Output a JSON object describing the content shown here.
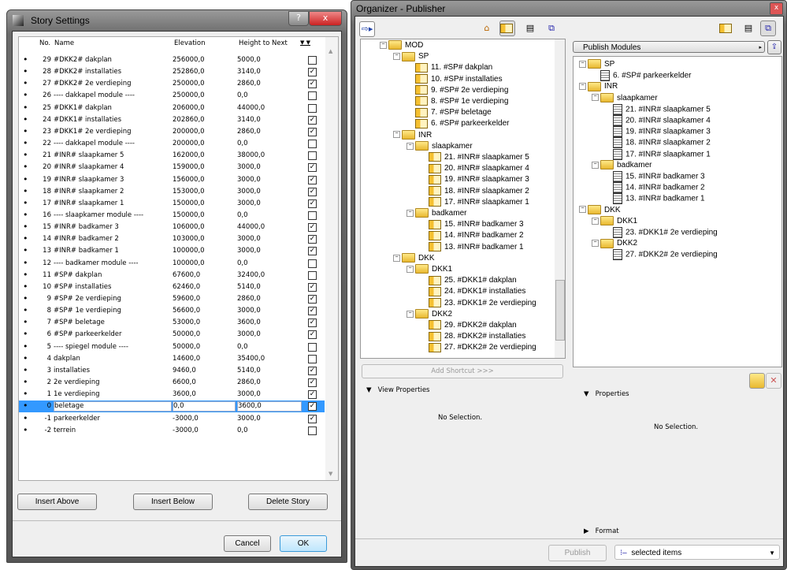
{
  "story_settings": {
    "title": "Story Settings",
    "help": "?",
    "close": "x",
    "columns": {
      "no": "No.",
      "name": "Name",
      "elevation": "Elevation",
      "height": "Height to Next"
    },
    "rows": [
      {
        "no": "29",
        "name": "#DKK2# dakplan",
        "elev": "256000,0",
        "height": "5000,0",
        "checked": false
      },
      {
        "no": "28",
        "name": "#DKK2# installaties",
        "elev": "252860,0",
        "height": "3140,0",
        "checked": true
      },
      {
        "no": "27",
        "name": "#DKK2# 2e verdieping",
        "elev": "250000,0",
        "height": "2860,0",
        "checked": true
      },
      {
        "no": "26",
        "name": "---- dakkapel module ----",
        "elev": "250000,0",
        "height": "0,0",
        "checked": false
      },
      {
        "no": "25",
        "name": "#DKK1# dakplan",
        "elev": "206000,0",
        "height": "44000,0",
        "checked": false
      },
      {
        "no": "24",
        "name": "#DKK1# installaties",
        "elev": "202860,0",
        "height": "3140,0",
        "checked": true
      },
      {
        "no": "23",
        "name": "#DKK1# 2e verdieping",
        "elev": "200000,0",
        "height": "2860,0",
        "checked": true
      },
      {
        "no": "22",
        "name": "---- dakkapel module ----",
        "elev": "200000,0",
        "height": "0,0",
        "checked": false
      },
      {
        "no": "21",
        "name": "#INR# slaapkamer 5",
        "elev": "162000,0",
        "height": "38000,0",
        "checked": false
      },
      {
        "no": "20",
        "name": "#INR# slaapkamer 4",
        "elev": "159000,0",
        "height": "3000,0",
        "checked": true
      },
      {
        "no": "19",
        "name": "#INR# slaapkamer 3",
        "elev": "156000,0",
        "height": "3000,0",
        "checked": true
      },
      {
        "no": "18",
        "name": "#INR# slaapkamer 2",
        "elev": "153000,0",
        "height": "3000,0",
        "checked": true
      },
      {
        "no": "17",
        "name": "#INR# slaapkamer 1",
        "elev": "150000,0",
        "height": "3000,0",
        "checked": true
      },
      {
        "no": "16",
        "name": "---- slaapkamer module ----",
        "elev": "150000,0",
        "height": "0,0",
        "checked": false
      },
      {
        "no": "15",
        "name": "#INR# badkamer 3",
        "elev": "106000,0",
        "height": "44000,0",
        "checked": true
      },
      {
        "no": "14",
        "name": "#INR# badkamer 2",
        "elev": "103000,0",
        "height": "3000,0",
        "checked": true
      },
      {
        "no": "13",
        "name": "#INR# badkamer 1",
        "elev": "100000,0",
        "height": "3000,0",
        "checked": true
      },
      {
        "no": "12",
        "name": "---- badkamer module ----",
        "elev": "100000,0",
        "height": "0,0",
        "checked": false
      },
      {
        "no": "11",
        "name": "#SP# dakplan",
        "elev": "67600,0",
        "height": "32400,0",
        "checked": false
      },
      {
        "no": "10",
        "name": "#SP# installaties",
        "elev": "62460,0",
        "height": "5140,0",
        "checked": true
      },
      {
        "no": "9",
        "name": "#SP# 2e verdieping",
        "elev": "59600,0",
        "height": "2860,0",
        "checked": true
      },
      {
        "no": "8",
        "name": "#SP# 1e verdieping",
        "elev": "56600,0",
        "height": "3000,0",
        "checked": true
      },
      {
        "no": "7",
        "name": "#SP# beletage",
        "elev": "53000,0",
        "height": "3600,0",
        "checked": true
      },
      {
        "no": "6",
        "name": "#SP# parkeerkelder",
        "elev": "50000,0",
        "height": "3000,0",
        "checked": true
      },
      {
        "no": "5",
        "name": "---- spiegel module ----",
        "elev": "50000,0",
        "height": "0,0",
        "checked": false
      },
      {
        "no": "4",
        "name": "dakplan",
        "elev": "14600,0",
        "height": "35400,0",
        "checked": false
      },
      {
        "no": "3",
        "name": "installaties",
        "elev": "9460,0",
        "height": "5140,0",
        "checked": true
      },
      {
        "no": "2",
        "name": "2e verdieping",
        "elev": "6600,0",
        "height": "2860,0",
        "checked": true
      },
      {
        "no": "1",
        "name": "1e verdieping",
        "elev": "3600,0",
        "height": "3000,0",
        "checked": true
      },
      {
        "no": "0",
        "name": "beletage",
        "elev": "0,0",
        "height": "3600,0",
        "checked": true,
        "selected": true
      },
      {
        "no": "-1",
        "name": "parkeerkelder",
        "elev": "-3000,0",
        "height": "3000,0",
        "checked": true
      },
      {
        "no": "-2",
        "name": "terrein",
        "elev": "-3000,0",
        "height": "0,0",
        "checked": false
      }
    ],
    "buttons": {
      "insert_above": "Insert Above",
      "insert_below": "Insert Below",
      "delete_story": "Delete Story",
      "cancel": "Cancel",
      "ok": "OK"
    }
  },
  "organizer": {
    "title": "Organizer - Publisher",
    "close": "x",
    "left_tree": [
      {
        "level": 0,
        "type": "folder",
        "label": "MOD"
      },
      {
        "level": 1,
        "type": "folder",
        "label": "SP"
      },
      {
        "level": 2,
        "type": "view",
        "label": "11. #SP# dakplan"
      },
      {
        "level": 2,
        "type": "view",
        "label": "10. #SP# installaties"
      },
      {
        "level": 2,
        "type": "view",
        "label": "9. #SP# 2e verdieping"
      },
      {
        "level": 2,
        "type": "view",
        "label": "8. #SP# 1e verdieping"
      },
      {
        "level": 2,
        "type": "view",
        "label": "7. #SP# beletage"
      },
      {
        "level": 2,
        "type": "view",
        "label": "6. #SP# parkeerkelder"
      },
      {
        "level": 1,
        "type": "folder",
        "label": "INR"
      },
      {
        "level": 2,
        "type": "folder",
        "label": "slaapkamer"
      },
      {
        "level": 3,
        "type": "view",
        "label": "21. #INR# slaapkamer 5"
      },
      {
        "level": 3,
        "type": "view",
        "label": "20. #INR# slaapkamer 4"
      },
      {
        "level": 3,
        "type": "view",
        "label": "19. #INR# slaapkamer 3"
      },
      {
        "level": 3,
        "type": "view",
        "label": "18. #INR# slaapkamer 2"
      },
      {
        "level": 3,
        "type": "view",
        "label": "17. #INR# slaapkamer 1"
      },
      {
        "level": 2,
        "type": "folder",
        "label": "badkamer"
      },
      {
        "level": 3,
        "type": "view",
        "label": "15. #INR# badkamer 3"
      },
      {
        "level": 3,
        "type": "view",
        "label": "14. #INR# badkamer 2"
      },
      {
        "level": 3,
        "type": "view",
        "label": "13. #INR# badkamer 1"
      },
      {
        "level": 1,
        "type": "folder",
        "label": "DKK"
      },
      {
        "level": 2,
        "type": "folder",
        "label": "DKK1"
      },
      {
        "level": 3,
        "type": "view",
        "label": "25. #DKK1# dakplan"
      },
      {
        "level": 3,
        "type": "view",
        "label": "24. #DKK1# installaties"
      },
      {
        "level": 3,
        "type": "view",
        "label": "23. #DKK1# 2e verdieping"
      },
      {
        "level": 2,
        "type": "folder",
        "label": "DKK2"
      },
      {
        "level": 3,
        "type": "view",
        "label": "29. #DKK2# dakplan"
      },
      {
        "level": 3,
        "type": "view",
        "label": "28. #DKK2# installaties"
      },
      {
        "level": 3,
        "type": "view",
        "label": "27. #DKK2# 2e verdieping"
      }
    ],
    "publish_set": "Publish Modules",
    "right_tree": [
      {
        "level": 0,
        "type": "folder",
        "label": "SP"
      },
      {
        "level": 1,
        "type": "doc",
        "label": "6. #SP# parkeerkelder"
      },
      {
        "level": 0,
        "type": "folder",
        "label": "INR"
      },
      {
        "level": 1,
        "type": "folder",
        "label": "slaapkamer"
      },
      {
        "level": 2,
        "type": "doc",
        "label": "21. #INR# slaapkamer 5"
      },
      {
        "level": 2,
        "type": "doc",
        "label": "20. #INR# slaapkamer 4"
      },
      {
        "level": 2,
        "type": "doc",
        "label": "19. #INR# slaapkamer 3"
      },
      {
        "level": 2,
        "type": "doc",
        "label": "18. #INR# slaapkamer 2"
      },
      {
        "level": 2,
        "type": "doc",
        "label": "17. #INR# slaapkamer 1"
      },
      {
        "level": 1,
        "type": "folder",
        "label": "badkamer"
      },
      {
        "level": 2,
        "type": "doc",
        "label": "15. #INR# badkamer 3"
      },
      {
        "level": 2,
        "type": "doc",
        "label": "14. #INR# badkamer 2"
      },
      {
        "level": 2,
        "type": "doc",
        "label": "13. #INR# badkamer 1"
      },
      {
        "level": 0,
        "type": "folder",
        "label": "DKK"
      },
      {
        "level": 1,
        "type": "folder",
        "label": "DKK1"
      },
      {
        "level": 2,
        "type": "doc",
        "label": "23. #DKK1# 2e verdieping"
      },
      {
        "level": 1,
        "type": "folder",
        "label": "DKK2"
      },
      {
        "level": 2,
        "type": "doc",
        "label": "27. #DKK2# 2e verdieping"
      }
    ],
    "add_shortcut": "Add Shortcut >>>",
    "view_properties": "View Properties",
    "no_selection_left": "No Selection.",
    "properties": "Properties",
    "no_selection_right": "No Selection.",
    "format": "Format",
    "publish": "Publish",
    "publish_scope": "selected items"
  }
}
